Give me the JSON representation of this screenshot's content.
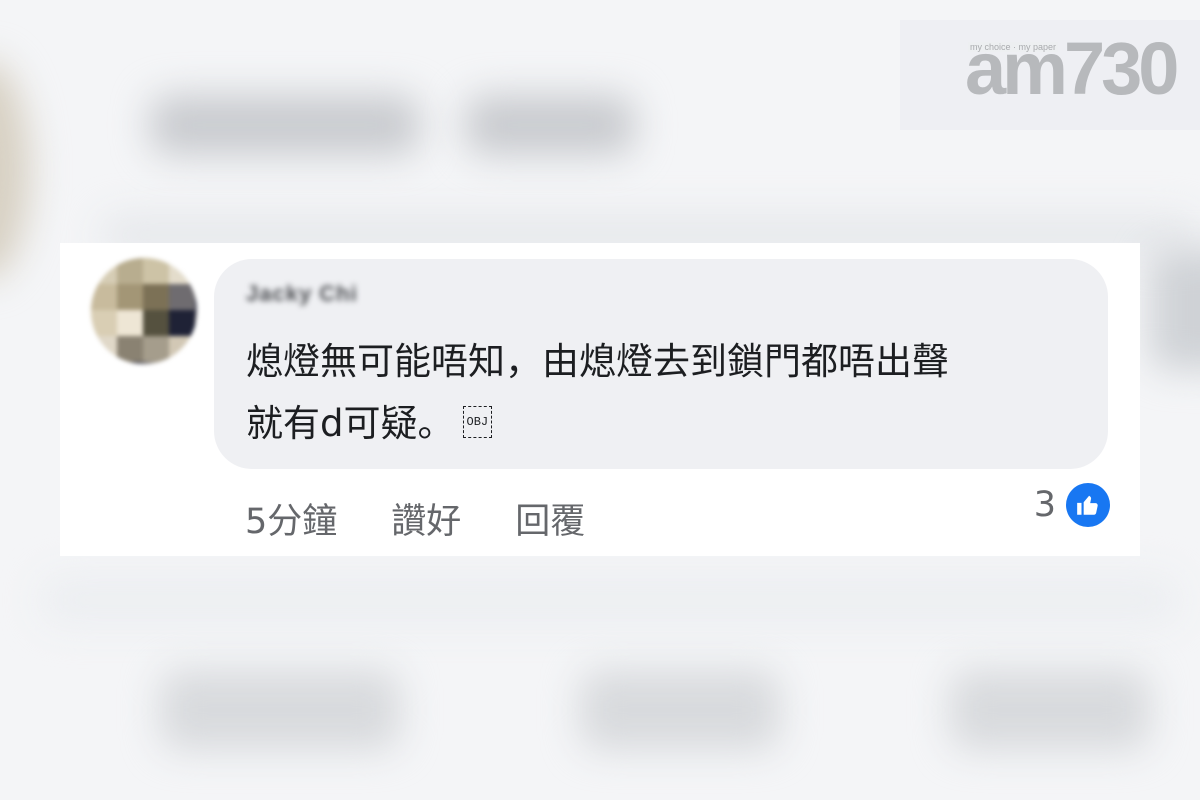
{
  "brand": {
    "logo": "am730",
    "tagline": "my choice · my paper"
  },
  "comment": {
    "author": "Jacky Chi",
    "text_line1": "熄燈無可能唔知，由熄燈去到鎖門都唔出聲",
    "text_line2": "就有d可疑。",
    "object_glyph": "OBJ",
    "timestamp": "5分鐘",
    "like_label": "讚好",
    "reply_label": "回覆",
    "reaction_count": "3",
    "reaction_icon": "thumbs-up-icon",
    "accent_color": "#1877f2"
  }
}
